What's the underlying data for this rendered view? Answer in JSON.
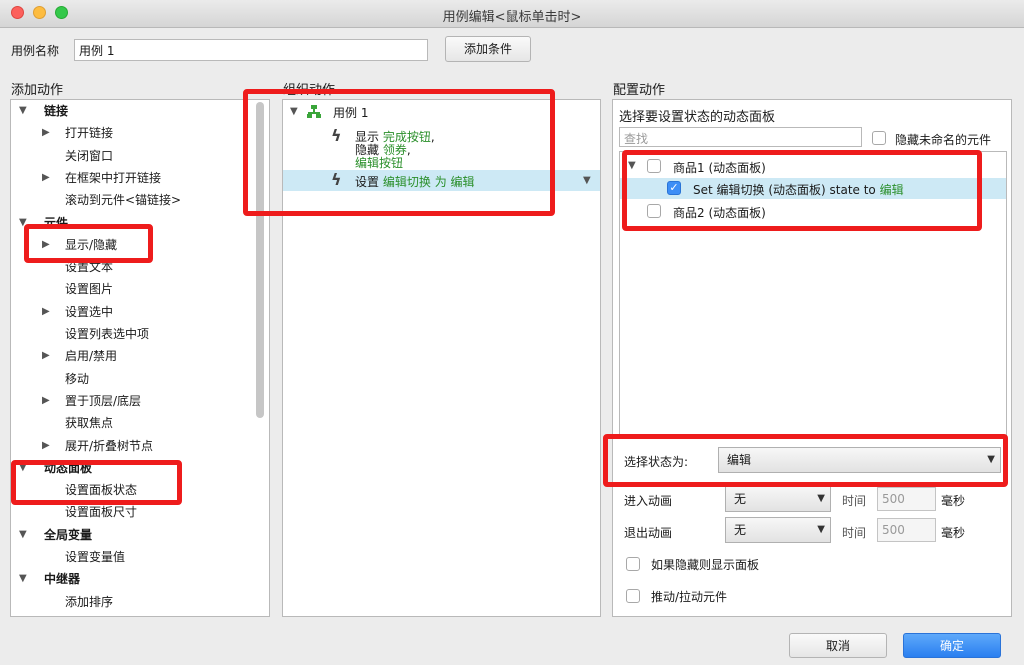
{
  "window": {
    "title": "用例编辑<鼠标单击时>"
  },
  "case_name": {
    "label": "用例名称",
    "value": "用例 1",
    "add_condition": "添加条件"
  },
  "sections": {
    "add_action": "添加动作",
    "organize_action": "组织动作",
    "configure_action": "配置动作"
  },
  "actions_tree": [
    {
      "label": "链接",
      "level": 0,
      "expander": "▼"
    },
    {
      "label": "打开链接",
      "level": 1,
      "expander": "▶"
    },
    {
      "label": "关闭窗口",
      "level": 1,
      "expander": ""
    },
    {
      "label": "在框架中打开链接",
      "level": 1,
      "expander": "▶"
    },
    {
      "label": "滚动到元件<锚链接>",
      "level": 1,
      "expander": ""
    },
    {
      "label": "元件",
      "level": 0,
      "expander": "▼"
    },
    {
      "label": "显示/隐藏",
      "level": 1,
      "expander": "▶"
    },
    {
      "label": "设置文本",
      "level": 1,
      "expander": ""
    },
    {
      "label": "设置图片",
      "level": 1,
      "expander": ""
    },
    {
      "label": "设置选中",
      "level": 1,
      "expander": "▶"
    },
    {
      "label": "设置列表选中项",
      "level": 1,
      "expander": ""
    },
    {
      "label": "启用/禁用",
      "level": 1,
      "expander": "▶"
    },
    {
      "label": "移动",
      "level": 1,
      "expander": ""
    },
    {
      "label": "置于顶层/底层",
      "level": 1,
      "expander": "▶"
    },
    {
      "label": "获取焦点",
      "level": 1,
      "expander": ""
    },
    {
      "label": "展开/折叠树节点",
      "level": 1,
      "expander": "▶"
    },
    {
      "label": "动态面板",
      "level": 0,
      "expander": "▼"
    },
    {
      "label": "设置面板状态",
      "level": 1,
      "expander": ""
    },
    {
      "label": "设置面板尺寸",
      "level": 1,
      "expander": ""
    },
    {
      "label": "全局变量",
      "level": 0,
      "expander": "▼"
    },
    {
      "label": "设置变量值",
      "level": 1,
      "expander": ""
    },
    {
      "label": "中继器",
      "level": 0,
      "expander": "▼"
    },
    {
      "label": "添加排序",
      "level": 1,
      "expander": ""
    }
  ],
  "organize": {
    "case_label": "用例 1",
    "action1": {
      "show_verb": "显示",
      "show_target": "完成按钮",
      "comma1": ",",
      "hide_verb": "隐藏",
      "hide_target1": "领券",
      "comma2": ",",
      "hide_target2": "编辑按钮"
    },
    "action2": {
      "verb": "设置",
      "target": "编辑切换",
      "mid": "为",
      "state": "编辑"
    }
  },
  "configure": {
    "panel_title": "选择要设置状态的动态面板",
    "search_placeholder": "查找",
    "hide_unnamed": "隐藏未命名的元件",
    "panels": {
      "p1": "商品1 (动态面板)",
      "p1_child_prefix": "Set 编辑切换 (动态面板) state to",
      "p1_child_state": "编辑",
      "p2": "商品2 (动态面板)"
    },
    "select_state_label": "选择状态为:",
    "select_state_value": "编辑",
    "enter_anim_label": "进入动画",
    "enter_anim_value": "无",
    "exit_anim_label": "退出动画",
    "exit_anim_value": "无",
    "time_label": "时间",
    "time_value": "500",
    "ms_label": "毫秒",
    "show_if_hidden": "如果隐藏则显示面板",
    "push_pull": "推动/拉动元件"
  },
  "footer": {
    "cancel": "取消",
    "ok": "确定"
  },
  "colors": {
    "highlight": "#ee1c1c",
    "accent": "#2a7ff0",
    "green_text": "#2a8f2a"
  }
}
